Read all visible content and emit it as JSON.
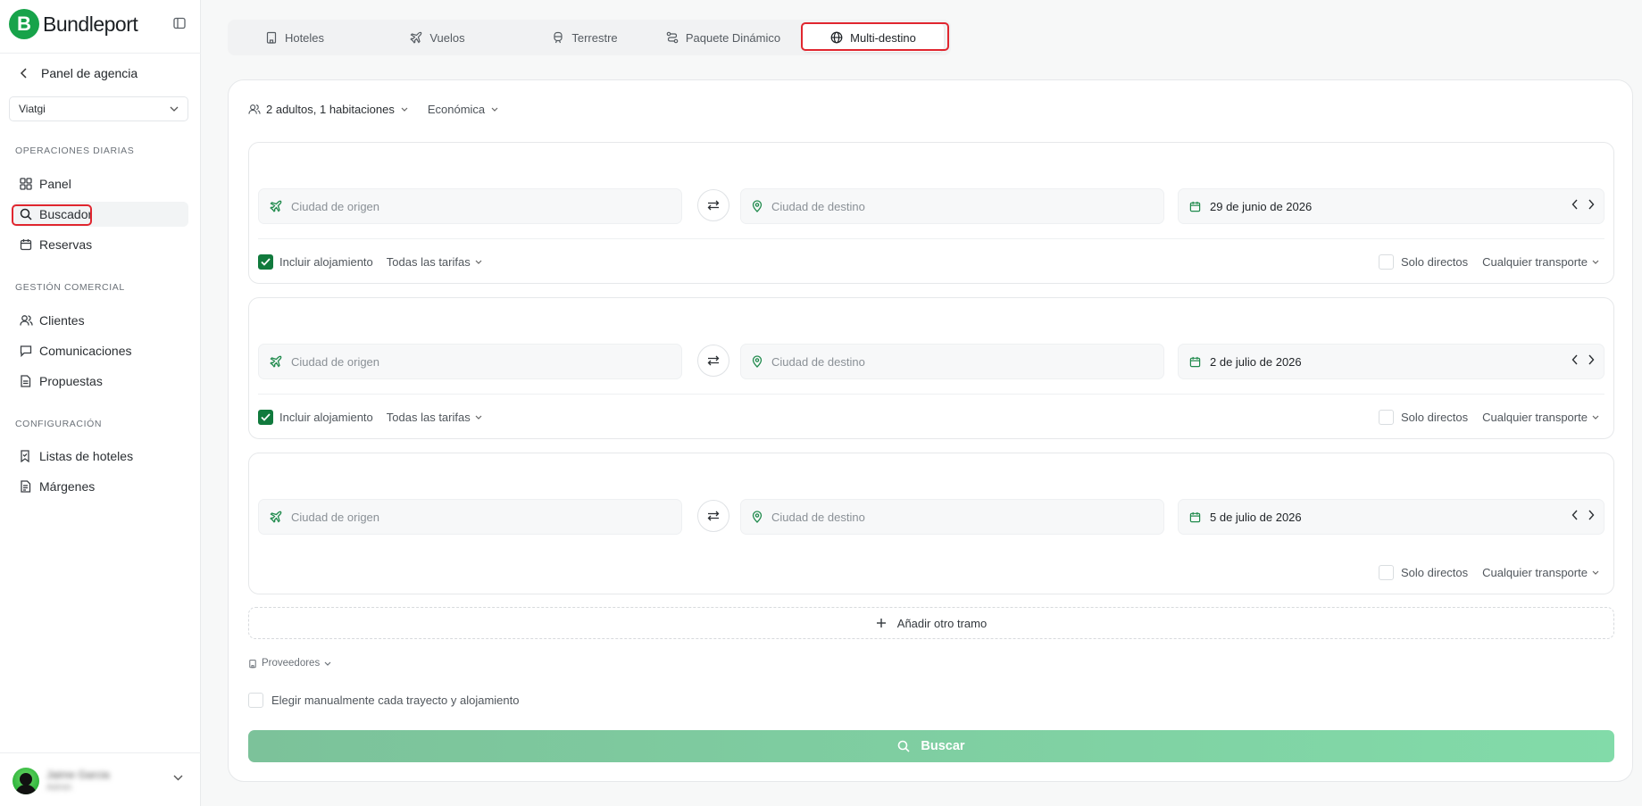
{
  "app": {
    "brand_letter": "B",
    "brand_name": "Bundleport"
  },
  "sidebar": {
    "back_label": "Panel de agencia",
    "agency_value": "Viatgi",
    "sections": {
      "daily": "OPERACIONES DIARIAS",
      "commercial": "GESTIÓN COMERCIAL",
      "config": "CONFIGURACIÓN"
    },
    "items": {
      "panel": "Panel",
      "buscador": "Buscador",
      "reservas": "Reservas",
      "clientes": "Clientes",
      "comunicaciones": "Comunicaciones",
      "propuestas": "Propuestas",
      "listas_hoteles": "Listas de hoteles",
      "margenes": "Márgenes"
    },
    "active_item": "Buscador",
    "user": {
      "name": "Jaime Garcia",
      "role": "Admin"
    }
  },
  "tabs": {
    "hoteles": "Hoteles",
    "vuelos": "Vuelos",
    "terrestre": "Terrestre",
    "paquete": "Paquete Dinámico",
    "multi": "Multi-destino",
    "active": "Multi-destino"
  },
  "search": {
    "pax_summary": "2 adultos, 1 habitaciones",
    "cabin_class": "Económica",
    "origin_placeholder": "Ciudad de origen",
    "destination_placeholder": "Ciudad de destino",
    "legs": [
      {
        "date": "29 de junio de 2026",
        "include_lodging_label": "Incluir alojamiento",
        "include_lodging": true,
        "fares": "Todas las tarifas",
        "direct_label": "Solo directos",
        "transport": "Cualquier transporte"
      },
      {
        "date": "2 de julio de 2026",
        "include_lodging_label": "Incluir alojamiento",
        "include_lodging": true,
        "fares": "Todas las tarifas",
        "direct_label": "Solo directos",
        "transport": "Cualquier transporte"
      },
      {
        "date": "5 de julio de 2026",
        "direct_label": "Solo directos",
        "transport": "Cualquier transporte"
      }
    ],
    "add_leg_label": "Añadir otro tramo",
    "providers_label": "Proveedores",
    "manual_label": "Elegir manualmente cada trayecto y alojamiento",
    "search_button": "Buscar"
  },
  "colors": {
    "brand_green": "#17a34a",
    "checkbox_green": "#117a3d",
    "highlight_red": "#e0262f",
    "search_button": "#82dba9"
  },
  "icons": {
    "collapse": "sidebar-toggle-icon",
    "back": "chevron-left-icon",
    "panel": "grid-icon",
    "buscador": "search-icon",
    "reservas": "calendar-icon",
    "clientes": "users-icon",
    "comunicaciones": "message-icon",
    "propuestas": "document-icon",
    "listas_hoteles": "bookmark-icon",
    "margenes": "receipt-icon"
  }
}
